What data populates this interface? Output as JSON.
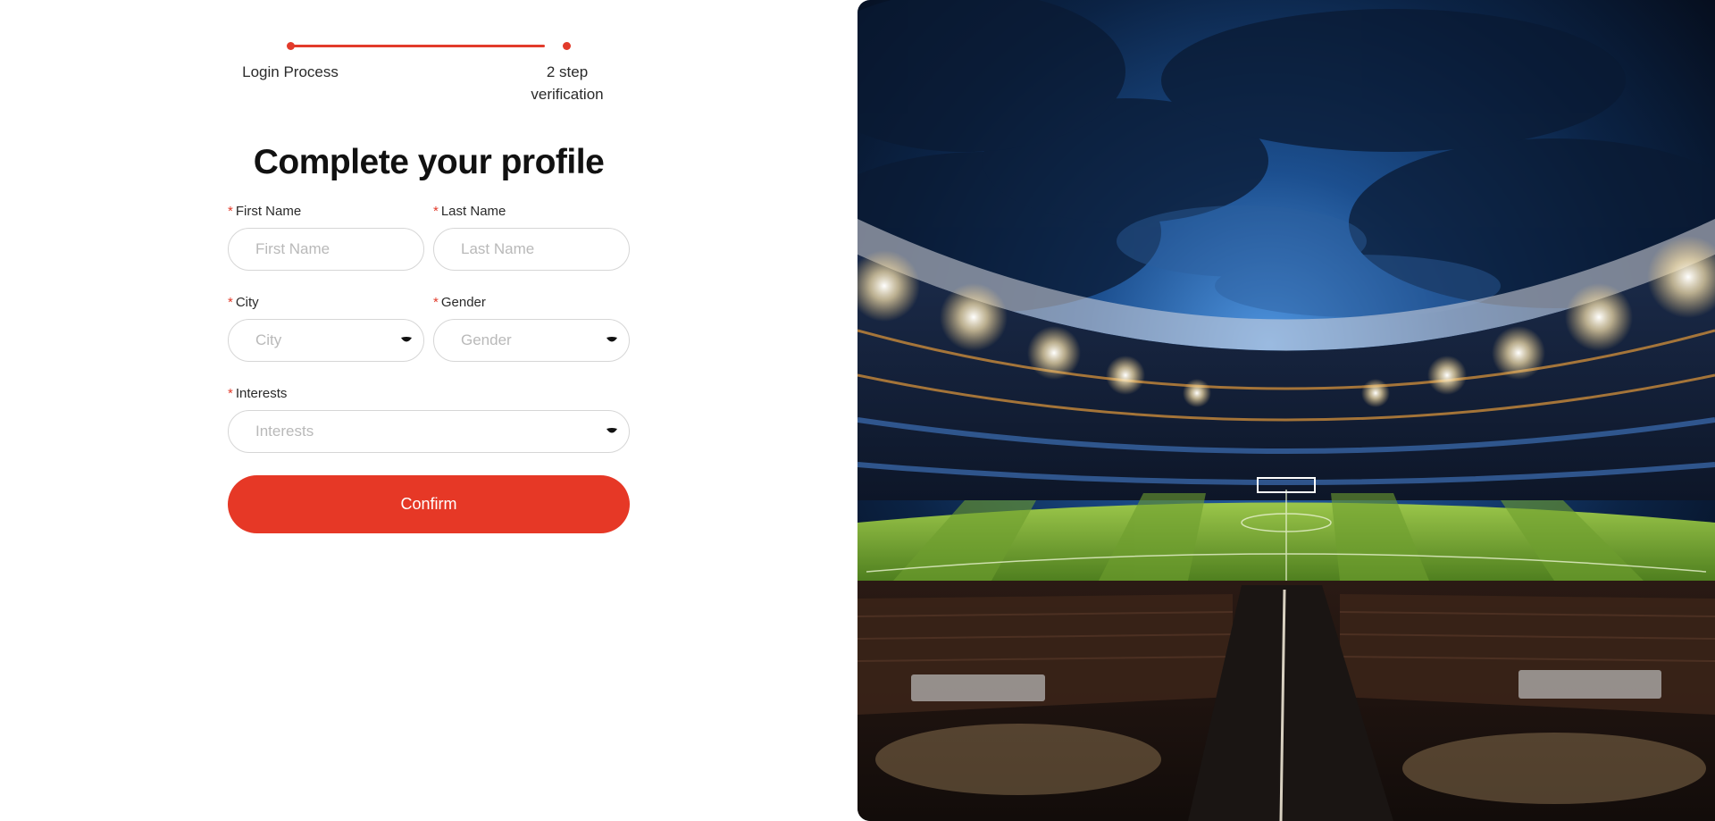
{
  "stepper": {
    "steps": [
      {
        "label": "Login Process"
      },
      {
        "label": "2 step\nverification"
      }
    ],
    "accent_color": "#e23b2b"
  },
  "form": {
    "title": "Complete your profile",
    "required_marker": "*",
    "first_name": {
      "label": "First Name",
      "placeholder": "First Name",
      "value": ""
    },
    "last_name": {
      "label": "Last Name",
      "placeholder": "Last Name",
      "value": ""
    },
    "city": {
      "label": "City",
      "placeholder": "City",
      "icon": "caret-down-icon"
    },
    "gender": {
      "label": "Gender",
      "placeholder": "Gender",
      "icon": "caret-down-icon"
    },
    "interests": {
      "label": "Interests",
      "placeholder": "Interests",
      "icon": "caret-down-icon"
    },
    "confirm_label": "Confirm",
    "button_color": "#e63826"
  },
  "hero": {
    "image": "stadium-night-photo"
  }
}
